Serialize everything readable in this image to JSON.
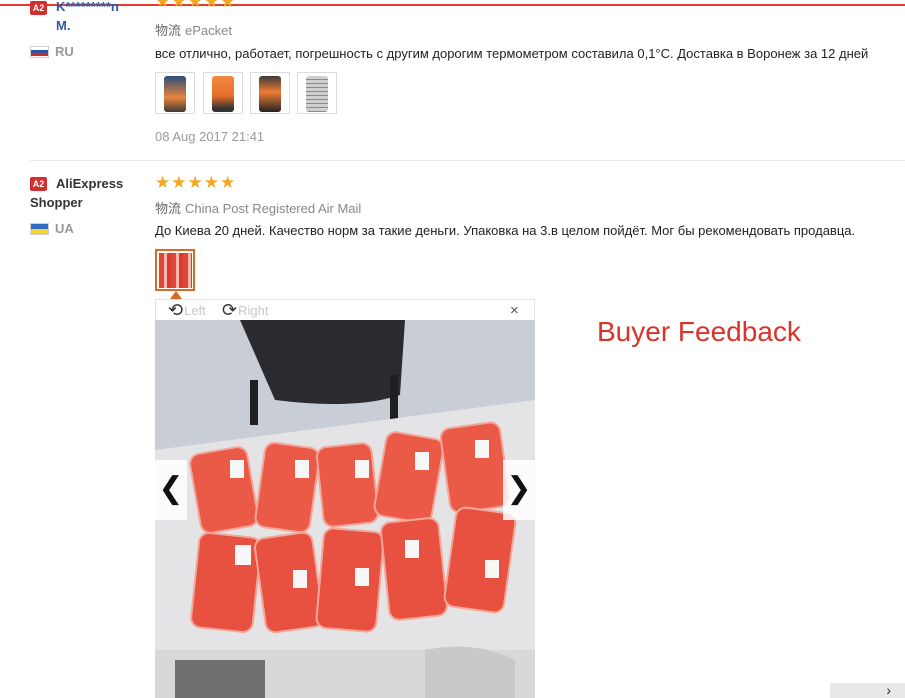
{
  "reviews": [
    {
      "level_badge": "A2",
      "name": "K*********n M.",
      "country": "RU",
      "ship_label": "物流",
      "ship_method": "ePacket",
      "text": "все отлично, работает, погрешность с другим дорогим термометром составила 0,1°С. Доставка в Воронеж за 12 дней",
      "date": "08 Aug 2017 21:41",
      "stars": "★★★★★",
      "thumbs": [
        "thermometer-photo-1",
        "thermometer-photo-2",
        "thermometer-photo-3",
        "manual-photo"
      ]
    },
    {
      "level_badge": "A2",
      "name_line1": "AliExpress",
      "name_line2": "Shopper",
      "country": "UA",
      "stars": "★★★★★",
      "ship_label": "物流",
      "ship_method": "China Post Registered Air Mail",
      "text": "До Киева 20 дней. Качество норм за такие деньги. Упаковка на 3.в целом пойдёт. Мог бы рекомендовать продавца.",
      "thumbs": [
        "packages-photo"
      ]
    }
  ],
  "viewer": {
    "rotate_left": "Left",
    "rotate_right": "Right",
    "close": "×",
    "prev": "❮",
    "next": "❯"
  },
  "caption": "Buyer Feedback",
  "corner_button": "›",
  "colors": {
    "accent": "#e43a2f",
    "star": "#f5a623",
    "caption": "#d9342b",
    "name_link": "#2d5aa6"
  }
}
